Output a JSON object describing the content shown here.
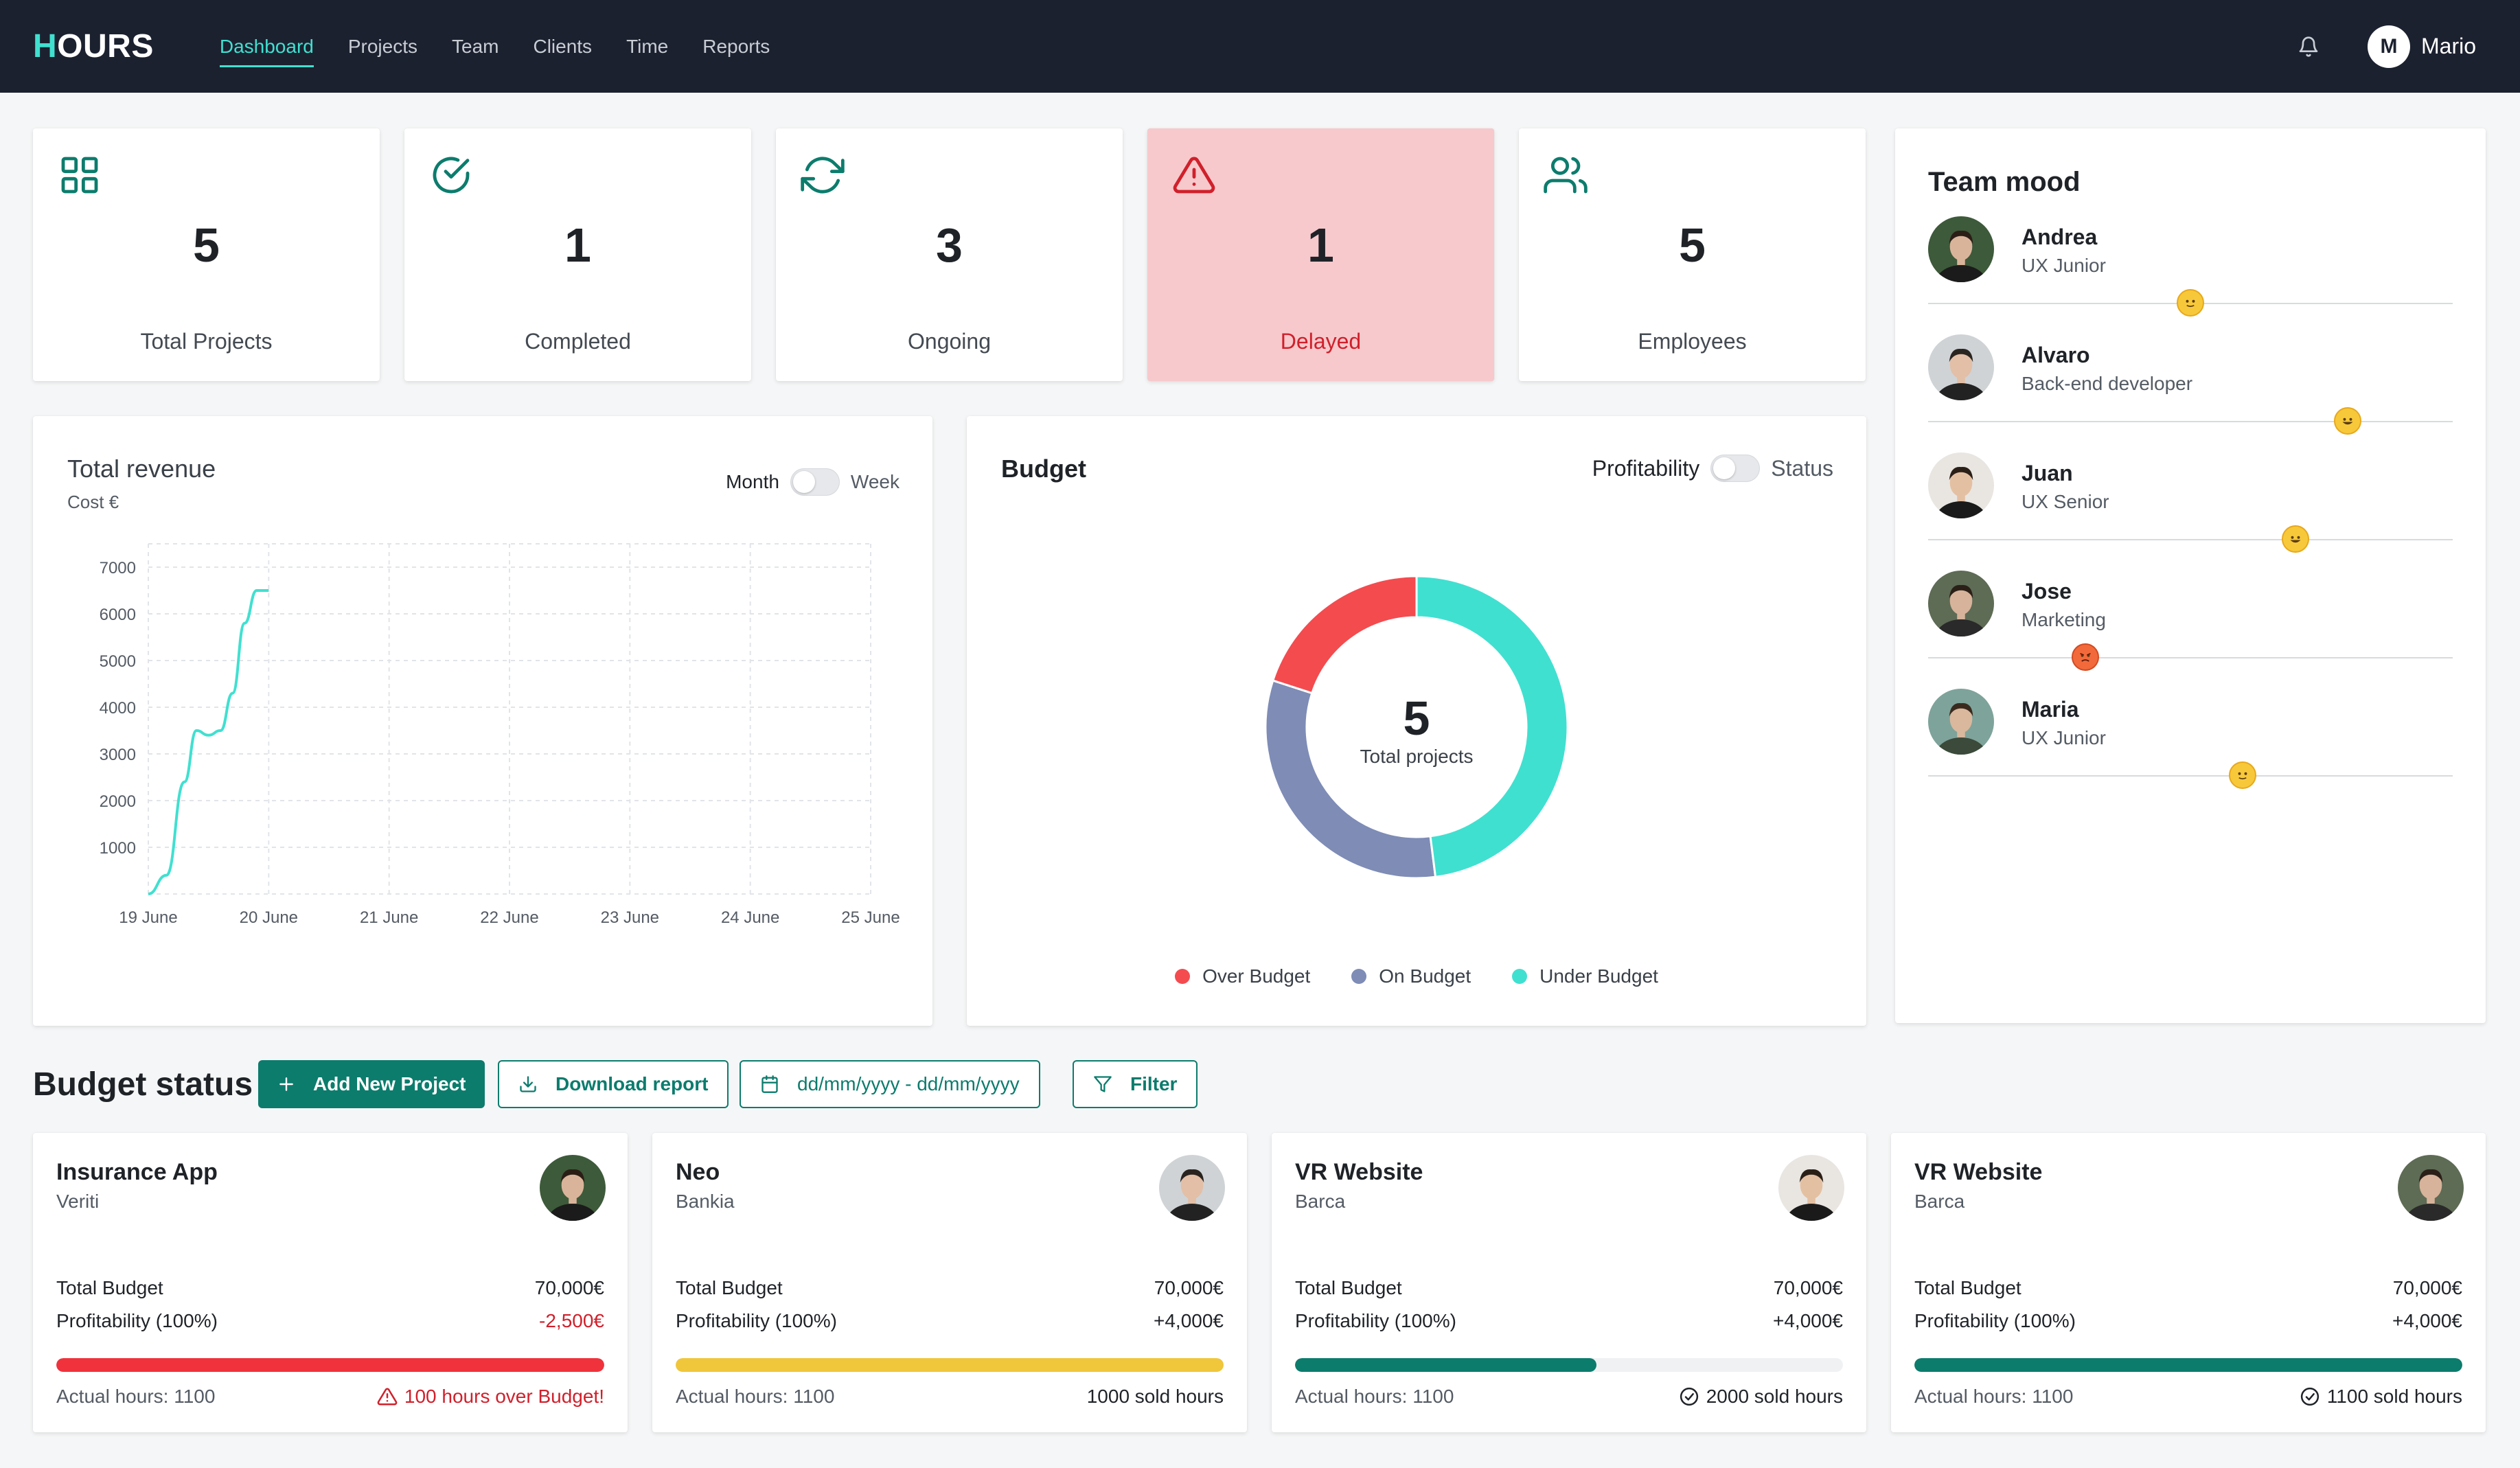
{
  "app": {
    "logo_first": "H",
    "logo_rest": "OURS",
    "nav": [
      "Dashboard",
      "Projects",
      "Team",
      "Clients",
      "Time",
      "Reports"
    ],
    "user_initial": "M",
    "user_name": "Mario",
    "accent": "#40e0d0",
    "brand_green": "#0c7c6d"
  },
  "stats": [
    {
      "value": "5",
      "label": "Total Projects",
      "icon": "grid-icon"
    },
    {
      "value": "1",
      "label": "Completed",
      "icon": "check-circle-icon"
    },
    {
      "value": "3",
      "label": "Ongoing",
      "icon": "refresh-icon"
    },
    {
      "value": "1",
      "label": "Delayed",
      "icon": "alert-triangle-icon"
    },
    {
      "value": "5",
      "label": "Employees",
      "icon": "users-icon"
    }
  ],
  "mood": {
    "title": "Team mood",
    "people": [
      {
        "name": "Andrea",
        "role": "UX Junior",
        "mood_level": 0.5,
        "mood": "neutral-face"
      },
      {
        "name": "Alvaro",
        "role": "Back-end developer",
        "mood_level": 0.8,
        "mood": "grinning-face"
      },
      {
        "name": "Juan",
        "role": "UX Senior",
        "mood_level": 0.7,
        "mood": "grinning-face"
      },
      {
        "name": "Jose",
        "role": "Marketing",
        "mood_level": 0.3,
        "mood": "angry-face"
      },
      {
        "name": "Maria",
        "role": "UX Junior",
        "mood_level": 0.6,
        "mood": "neutral-face"
      }
    ]
  },
  "revenue": {
    "title": "Total revenue",
    "subtitle": "Cost €",
    "toggle_left": "Month",
    "toggle_right": "Week",
    "chart_data": {
      "type": "line",
      "title": "Total revenue",
      "ylabel": "Cost €",
      "x_ticks": [
        "19 June",
        "20 June",
        "21 June",
        "22 June",
        "23 June",
        "24 June",
        "25 June"
      ],
      "y_ticks": [
        1000,
        2000,
        3000,
        4000,
        5000,
        6000,
        7000
      ],
      "ylim": [
        0,
        7500
      ],
      "grid": true,
      "series": [
        {
          "color": "#40e0d0",
          "points": [
            [
              0.0,
              0
            ],
            [
              0.15,
              400
            ],
            [
              0.3,
              2400
            ],
            [
              0.4,
              3500
            ],
            [
              0.5,
              3400
            ],
            [
              0.6,
              3500
            ],
            [
              0.7,
              4300
            ],
            [
              0.8,
              5800
            ],
            [
              0.9,
              6500
            ],
            [
              1.0,
              6500
            ]
          ]
        }
      ]
    }
  },
  "budget": {
    "title": "Budget",
    "toggle_left": "Profitability",
    "toggle_right": "Status",
    "center_value": "5",
    "center_label": "Total projects",
    "chart_data": {
      "type": "pie",
      "slices": [
        {
          "label": "Over Budget",
          "value": 1,
          "color": "#f44b4f"
        },
        {
          "label": "On Budget",
          "value": 1.6,
          "color": "#7e8cb6"
        },
        {
          "label": "Under Budget",
          "value": 2.4,
          "color": "#40e0d0"
        }
      ]
    }
  },
  "budget_status": {
    "title": "Budget status",
    "add_label": "Add New Project",
    "download_label": "Download report",
    "date_label": "dd/mm/yyyy - dd/mm/yyyy",
    "filter_label": "Filter"
  },
  "projects": [
    {
      "name": "Insurance App",
      "client": "Veriti",
      "total_label": "Total Budget",
      "total": "70,000€",
      "profit_label": "Profitability (100%)",
      "profit": "-2,500€",
      "negative": true,
      "hours": "Actual hours: 1100",
      "status": "100 hours over Budget!",
      "warn": true,
      "progress": 1.0,
      "bar_color": "#f0323c"
    },
    {
      "name": "Neo",
      "client": "Bankia",
      "total_label": "Total Budget",
      "total": "70,000€",
      "profit_label": "Profitability (100%)",
      "profit": "+4,000€",
      "negative": false,
      "hours": "Actual hours: 1100",
      "status": "1000 sold hours",
      "warn": false,
      "check": false,
      "progress": 1.0,
      "bar_color": "#f0c63a"
    },
    {
      "name": "VR Website",
      "client": "Barca",
      "total_label": "Total Budget",
      "total": "70,000€",
      "profit_label": "Profitability (100%)",
      "profit": "+4,000€",
      "negative": false,
      "hours": "Actual hours: 1100",
      "status": "2000 sold hours",
      "warn": false,
      "check": true,
      "progress": 0.55,
      "bar_color": "#0c7c6d"
    },
    {
      "name": "VR Website",
      "client": "Barca",
      "total_label": "Total Budget",
      "total": "70,000€",
      "profit_label": "Profitability (100%)",
      "profit": "+4,000€",
      "negative": false,
      "hours": "Actual hours: 1100",
      "status": "1100 sold hours",
      "warn": false,
      "check": true,
      "progress": 1.0,
      "bar_color": "#0c7c6d"
    }
  ]
}
